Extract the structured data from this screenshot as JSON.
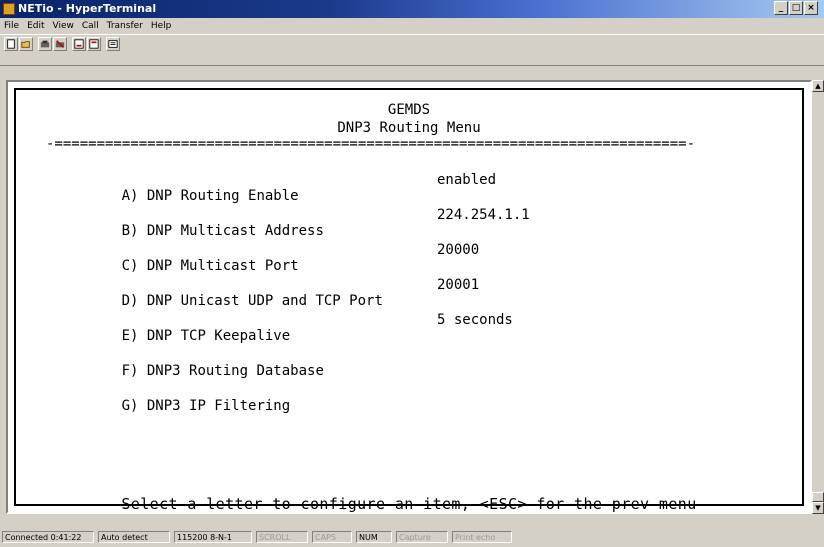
{
  "window": {
    "title": "NETio - HyperTerminal"
  },
  "menu": [
    "File",
    "Edit",
    "View",
    "Call",
    "Transfer",
    "Help"
  ],
  "toolbar": [
    "new-icon",
    "open-icon",
    "call-icon",
    "disconnect-icon",
    "send-icon",
    "receive-icon",
    "properties-icon"
  ],
  "terminal": {
    "header_line1": "GEMDS",
    "header_line2": "DNP3 Routing Menu",
    "divider": "-===========================================================================-",
    "items": [
      {
        "key": "A)",
        "label": "DNP Routing Enable",
        "value": "enabled"
      },
      {
        "key": "B)",
        "label": "DNP Multicast Address",
        "value": "224.254.1.1"
      },
      {
        "key": "C)",
        "label": "DNP Multicast Port",
        "value": "20000"
      },
      {
        "key": "D)",
        "label": "DNP Unicast UDP and TCP Port",
        "value": "20001"
      },
      {
        "key": "E)",
        "label": "DNP TCP Keepalive",
        "value": "5 seconds"
      },
      {
        "key": "F)",
        "label": "DNP3 Routing Database",
        "value": ""
      },
      {
        "key": "G)",
        "label": "DNP3 IP Filtering",
        "value": ""
      }
    ],
    "prompt": "Select a letter to configure an item, <ESC> for the prev menu"
  },
  "status": {
    "connected": "Connected 0:41:22",
    "detect": "Auto detect",
    "settings": "115200 8-N-1",
    "scroll": "SCROLL",
    "caps": "CAPS",
    "num": "NUM",
    "capture": "Capture",
    "print_echo": "Print echo"
  }
}
